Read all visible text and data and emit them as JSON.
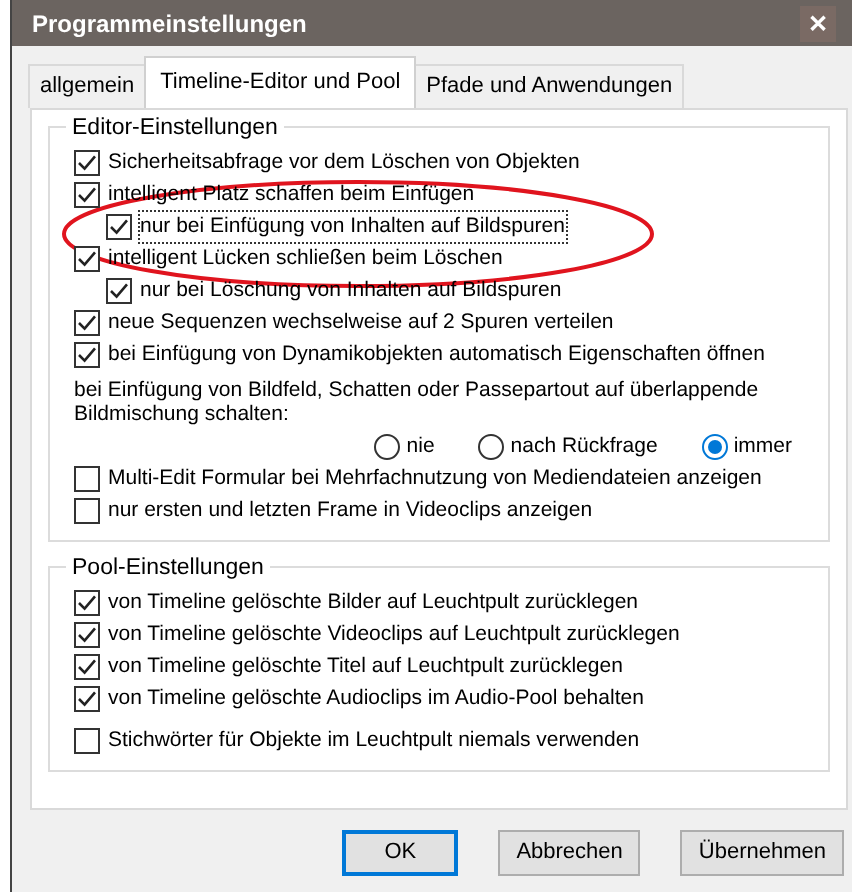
{
  "window": {
    "title": "Programmeinstellungen",
    "close": "✕"
  },
  "tabs": [
    {
      "label": "allgemein",
      "selected": false
    },
    {
      "label": "Timeline-Editor und Pool",
      "selected": true
    },
    {
      "label": "Pfade und Anwendungen",
      "selected": false
    }
  ],
  "editor": {
    "title": "Editor-Einstellungen",
    "options": [
      {
        "kind": "checkbox",
        "label": "Sicherheitsabfrage vor dem Löschen von Objekten",
        "checked": true
      },
      {
        "kind": "checkbox",
        "label": "intelligent Platz schaffen beim Einfügen",
        "checked": true,
        "children": [
          {
            "kind": "checkbox",
            "label": "nur bei Einfügung von Inhalten auf Bildspuren",
            "checked": true,
            "focused": true
          }
        ]
      },
      {
        "kind": "checkbox",
        "label": "intelligent Lücken schließen beim Löschen",
        "checked": true,
        "children": [
          {
            "kind": "checkbox",
            "label": "nur bei Löschung von Inhalten auf Bildspuren",
            "checked": true
          }
        ]
      },
      {
        "kind": "checkbox",
        "label": "neue Sequenzen wechselweise auf 2 Spuren verteilen",
        "checked": true
      },
      {
        "kind": "checkbox",
        "label": "bei Einfügung von Dynamikobjekten automatisch Eigenschaften öffnen",
        "checked": true
      },
      {
        "kind": "radio",
        "label": "bei Einfügung von Bildfeld, Schatten oder Passepartout auf überlappende Bildmischung schalten:",
        "choices": [
          {
            "label": "nie",
            "selected": false
          },
          {
            "label": "nach Rückfrage",
            "selected": false
          },
          {
            "label": "immer",
            "selected": true
          }
        ]
      },
      {
        "kind": "checkbox",
        "label": "Multi-Edit Formular bei Mehrfachnutzung von Mediendateien anzeigen",
        "checked": false
      },
      {
        "kind": "checkbox",
        "label": "nur ersten und letzten Frame in Videoclips anzeigen",
        "checked": false
      }
    ]
  },
  "pool": {
    "title": "Pool-Einstellungen",
    "options": [
      {
        "kind": "checkbox",
        "label": "von Timeline gelöschte Bilder auf Leuchtpult zurücklegen",
        "checked": true
      },
      {
        "kind": "checkbox",
        "label": "von Timeline gelöschte Videoclips auf Leuchtpult zurücklegen",
        "checked": true
      },
      {
        "kind": "checkbox",
        "label": "von Timeline gelöschte Titel auf Leuchtpult zurücklegen",
        "checked": true
      },
      {
        "kind": "checkbox",
        "label": "von Timeline gelöschte Audioclips im Audio-Pool behalten",
        "checked": true
      },
      {
        "kind": "checkbox",
        "label": "Stichwörter für Objekte im Leuchtpult niemals verwenden",
        "checked": false
      }
    ]
  },
  "buttons": [
    {
      "label": "OK",
      "default": true
    },
    {
      "label": "Abbrechen",
      "default": false
    },
    {
      "label": "Übernehmen",
      "default": false
    }
  ]
}
